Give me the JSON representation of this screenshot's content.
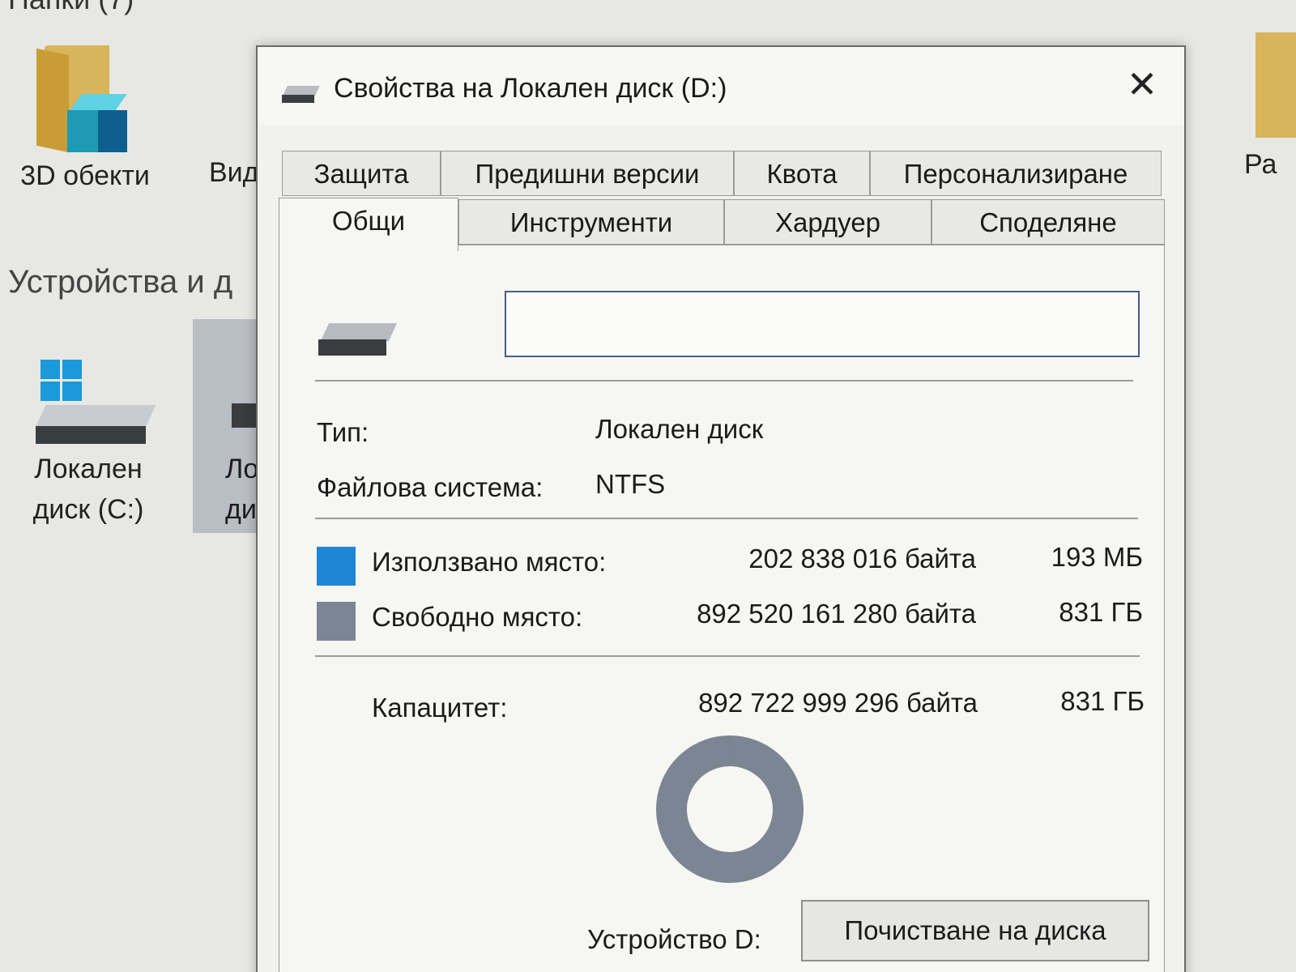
{
  "background": {
    "folders_heading": "Папки (7)",
    "item_3d": "3D обекти",
    "item_video_partial": "Вид",
    "devices_heading": "Устройства и д",
    "drive_c_line1": "Локален",
    "drive_c_line2": "диск (C:)",
    "drive_partial_line1": "Ло",
    "drive_partial_line2": "ди",
    "right_partial": "Ра"
  },
  "dialog": {
    "title": "Свойства на Локален диск (D:)",
    "close_glyph": "✕",
    "tabs_row1": [
      "Защита",
      "Предишни версии",
      "Квота",
      "Персонализиране"
    ],
    "tabs_row2": [
      "Общи",
      "Инструменти",
      "Хардуер",
      "Споделяне"
    ],
    "active_tab": "Общи",
    "name_value": "",
    "type_label": "Тип:",
    "type_value": "Локален диск",
    "fs_label": "Файлова система:",
    "fs_value": "NTFS",
    "used_label": "Използвано място:",
    "used_bytes": "202 838 016 байта",
    "used_size": "193 МБ",
    "free_label": "Свободно място:",
    "free_bytes": "892 520 161 280 байта",
    "free_size": "831 ГБ",
    "capacity_label": "Капацитет:",
    "capacity_bytes": "892 722 999 296 байта",
    "capacity_size": "831 ГБ",
    "drive_label": "Устройство D:",
    "cleanup_button": "Почистване на диска",
    "used_fraction": 0.000227,
    "colors": {
      "used": "#1f86d6",
      "free": "#7c8593"
    }
  }
}
